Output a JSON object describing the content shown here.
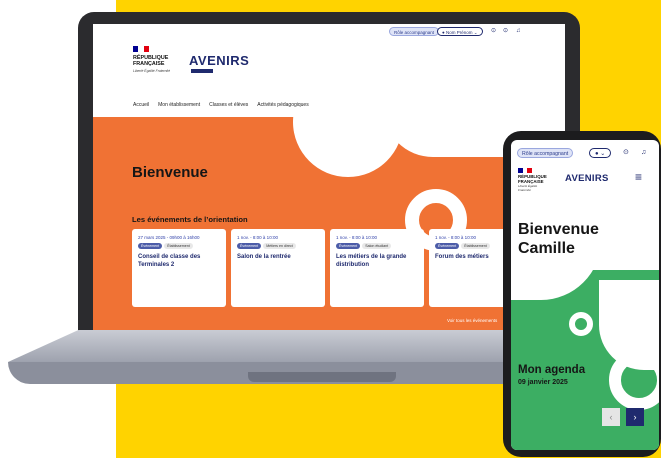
{
  "colors": {
    "yellow": "#FFD300",
    "orange": "#F07234",
    "green": "#3cae63",
    "navy": "#1f2a6e",
    "flag_blue": "#000091",
    "flag_red": "#e1000f"
  },
  "desktop": {
    "header": {
      "role_label": "Rôle accompagnant",
      "user_label": "Nom Prénom",
      "icons": [
        "user-icon",
        "chevron-down-icon",
        "help-icon",
        "settings-icon",
        "bell-icon"
      ]
    },
    "brand": {
      "republic": "RÉPUBLIQUE FRANÇAISE",
      "motto": "Liberté Égalité Fraternité",
      "logo": "AVENIRS"
    },
    "nav": [
      "Accueil",
      "Mon établissement",
      "Classes et élèves",
      "Activités pédagogiques"
    ],
    "hero": {
      "welcome": "Bienvenue",
      "events_title": "Les événements de l’orientation",
      "see_all": "Voir tous les événements",
      "cards": [
        {
          "date": "27 mars 2025 - 09h00 à 16h00",
          "tags": [
            "Événement",
            "Établissement"
          ],
          "title": "Conseil de classe des Terminales 2"
        },
        {
          "date": "1 nov. - 8:00 à 10:00",
          "tags": [
            "Événement",
            "Métiers en direct"
          ],
          "title": "Salon de la rentrée"
        },
        {
          "date": "1 nov. - 8:00 à 10:00",
          "tags": [
            "Événement",
            "Salon étudiant"
          ],
          "title": "Les métiers de la grande distribution"
        },
        {
          "date": "1 nov. - 8:00 à 10:00",
          "tags": [
            "Événement",
            "Établissement"
          ],
          "title": "Forum des métiers"
        }
      ]
    }
  },
  "mobile": {
    "role_label": "Rôle accompagnant",
    "republic": "RÉPUBLIQUE FRANÇAISE",
    "motto": "Liberté Égalité Fraternité",
    "logo": "AVENIRS",
    "welcome": "Bienvenue Camille",
    "agenda_title": "Mon agenda",
    "agenda_date": "09 janvier 2025",
    "icons": [
      "user-icon",
      "chevron-down-icon",
      "help-icon",
      "bell-icon",
      "menu-icon",
      "chevron-left-icon",
      "chevron-right-icon"
    ]
  }
}
